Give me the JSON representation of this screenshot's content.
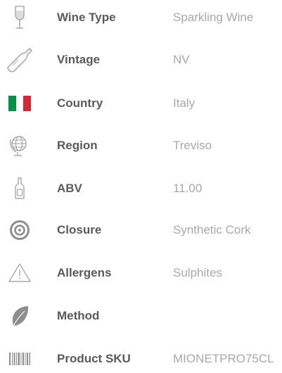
{
  "specs": [
    {
      "icon": "wine-glass-icon",
      "label": "Wine Type",
      "value": "Sparkling Wine"
    },
    {
      "icon": "wine-bottle-icon",
      "label": "Vintage",
      "value": "NV"
    },
    {
      "icon": "italy-flag-icon",
      "label": "Country",
      "value": "Italy"
    },
    {
      "icon": "globe-icon",
      "label": "Region",
      "value": "Treviso"
    },
    {
      "icon": "small-bottle-icon",
      "label": "ABV",
      "value": "11.00"
    },
    {
      "icon": "target-icon",
      "label": "Closure",
      "value": "Synthetic Cork"
    },
    {
      "icon": "warning-triangle-icon",
      "label": "Allergens",
      "value": "Sulphites"
    },
    {
      "icon": "leaf-icon",
      "label": "Method",
      "value": ""
    },
    {
      "icon": "barcode-icon",
      "label": "Product SKU",
      "value": "MIONETPRO75CL"
    }
  ],
  "colors": {
    "label": "#5a5a5a",
    "value": "#a8a8a8",
    "icon": "#9a9a9a",
    "flag_green": "#009246",
    "flag_white": "#ffffff",
    "flag_red": "#ce2b37"
  }
}
